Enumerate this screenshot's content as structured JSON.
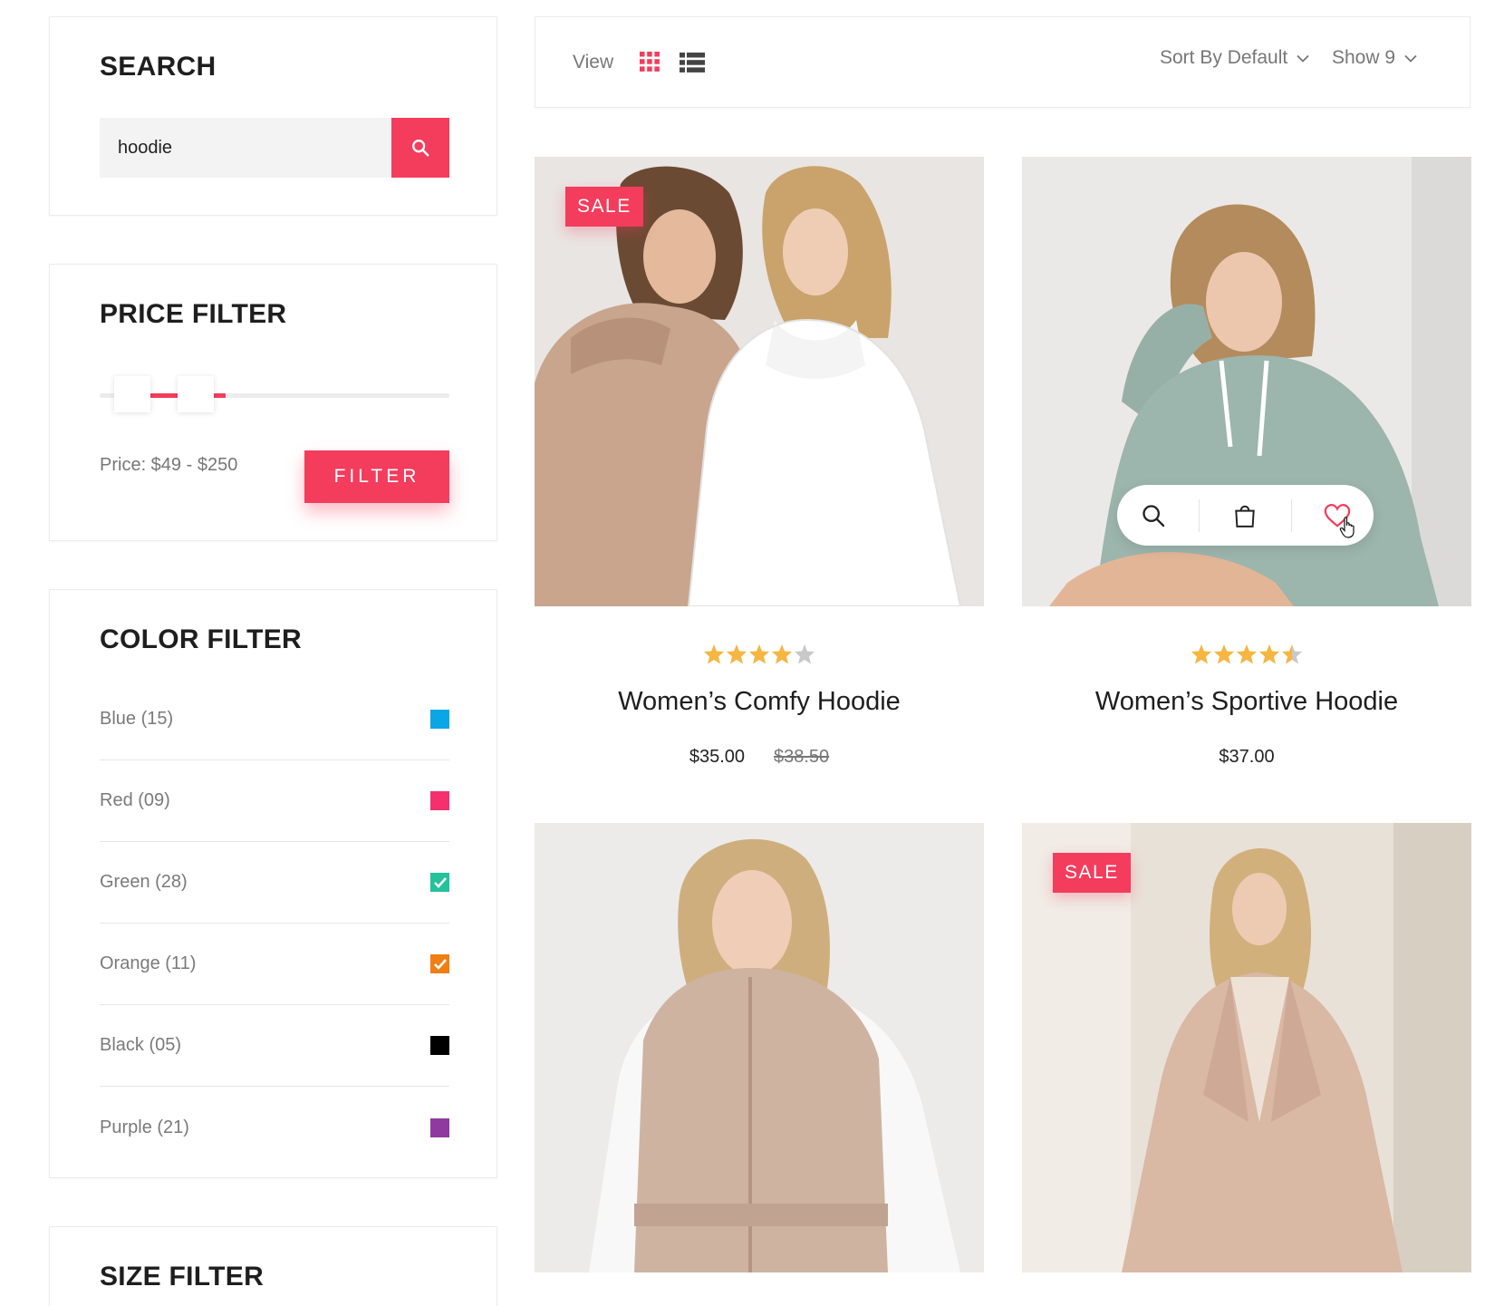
{
  "sidebar": {
    "search": {
      "title": "SEARCH",
      "query": "hoodie",
      "button_icon": "search-icon"
    },
    "price_filter": {
      "title": "PRICE FILTER",
      "price_text": "Price: $49 - $250",
      "range_low": 49,
      "range_high": 250,
      "button_label": "FILTER"
    },
    "color_filter": {
      "title": "COLOR FILTER",
      "items": [
        {
          "label": "Blue (15)",
          "color": "#0aa6e6",
          "checked": false
        },
        {
          "label": "Red (09)",
          "color": "#f4316e",
          "checked": false
        },
        {
          "label": "Green (28)",
          "color": "#22c29a",
          "checked": true
        },
        {
          "label": "Orange (11)",
          "color": "#f07f14",
          "checked": true
        },
        {
          "label": "Black (05)",
          "color": "#000000",
          "checked": false
        },
        {
          "label": "Purple (21)",
          "color": "#8e3a9e",
          "checked": false
        }
      ]
    },
    "size_filter": {
      "title": "SIZE FILTER"
    }
  },
  "toolbar": {
    "view_label": "View",
    "view_modes": [
      "grid-icon",
      "list-icon"
    ],
    "active_view": "grid",
    "sort_label": "Sort By Default",
    "show_label": "Show 9"
  },
  "products": [
    {
      "name": "Women’s Comfy Hoodie",
      "price": "$35.00",
      "old_price": "$38.50",
      "rating": 4,
      "badge": "SALE"
    },
    {
      "name": "Women’s Sportive Hoodie",
      "price": "$37.00",
      "old_price": "",
      "rating": 4.5,
      "badge": ""
    },
    {
      "name": "",
      "price": "",
      "old_price": "",
      "rating": 0,
      "badge": ""
    },
    {
      "name": "",
      "price": "",
      "old_price": "",
      "rating": 0,
      "badge": "SALE"
    }
  ],
  "colors": {
    "accent": "#f43c5c",
    "star": "#f5b642",
    "star_empty": "#c9c9c9"
  }
}
